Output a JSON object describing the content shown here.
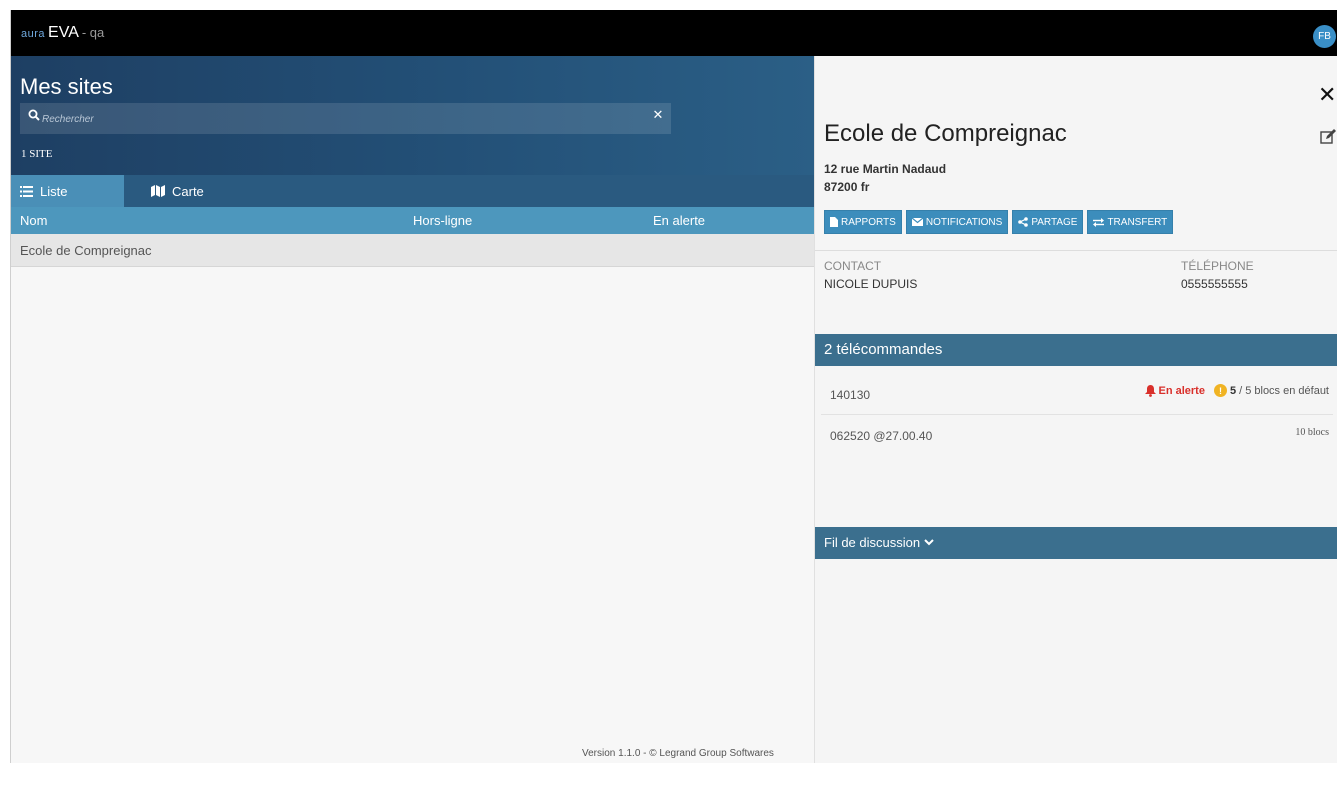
{
  "topbar": {
    "logo_text": "aura",
    "app_name": "EVA",
    "env_label": "- qa",
    "user_initials": "FB"
  },
  "sites": {
    "title": "Mes sites",
    "search_placeholder": "Rechercher",
    "count_label": "1 SITE",
    "tabs": [
      {
        "label": "Liste",
        "icon": "list-icon",
        "active": true
      },
      {
        "label": "Carte",
        "icon": "map-icon",
        "active": false
      }
    ],
    "columns": [
      "Nom",
      "Hors-ligne",
      "En alerte"
    ],
    "rows": [
      {
        "name": "Ecole de Compreignac"
      }
    ],
    "footer": "Version 1.1.0 - © Legrand Group Softwares"
  },
  "detail": {
    "name": "Ecole de Compreignac",
    "address_line1": "12 rue Martin Nadaud",
    "address_line2": "87200 fr",
    "actions": [
      {
        "label": "RAPPORTS",
        "icon": "file-icon"
      },
      {
        "label": "NOTIFICATIONS",
        "icon": "envelope-icon"
      },
      {
        "label": "PARTAGE",
        "icon": "share-icon"
      },
      {
        "label": "TRANSFERT",
        "icon": "transfer-icon"
      }
    ],
    "contact_label": "CONTACT",
    "contact_value": "NICOLE DUPUIS",
    "phone_label": "TÉLÉPHONE",
    "phone_value": "0555555555",
    "remotes_title": "2 télécommandes",
    "remotes": [
      {
        "id": "140130",
        "status": "En alerte",
        "faulty": "5",
        "faulty_suffix": "/ 5 blocs en défaut"
      },
      {
        "id": "062520 @27.00.40",
        "blocks": "10 blocs"
      }
    ],
    "discussion_title": "Fil de discussion"
  },
  "colors": {
    "topbar": "#000000",
    "header_dark": "#1e3f63",
    "tab_active": "#4a8fb7",
    "table_header": "#4d97bd",
    "panel_header": "#3b6f8e",
    "action_button": "#3c8dbc",
    "alert": "#d9302b",
    "warning": "#f0b323"
  }
}
